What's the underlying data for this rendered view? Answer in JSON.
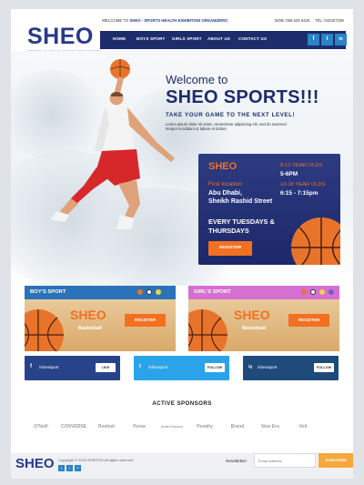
{
  "header": {
    "logo": "SHEO",
    "logo_tagline": "SPORTS HEALTH EXHIBITION ORGANIZERS",
    "welcome_prefix": "WELCOME TO",
    "welcome_brand": "SHEO - SPORTS HEALTH EXHIBITION ORGANIZERS",
    "mob": "MOB: 055 626 6426",
    "tel": "TEL: 044307199"
  },
  "nav": {
    "items": [
      "HOME",
      "BOYS SPORT",
      "GIRLS SPORT",
      "ABOUT US",
      "CONTACT US"
    ],
    "social": [
      "f",
      "t",
      "in"
    ]
  },
  "hero": {
    "welcome": "Welcome to",
    "title": "SHEO SPORTS!!!",
    "subtitle": "TAKE YOUR GAME TO THE NEXT LEVEL!",
    "lorem_1": "Lorem ipsum dolor sit amet, consectetur adipiscing elit, sed do eiusmod",
    "lorem_2": "tempor incididunt ut labore et dolore."
  },
  "info_card": {
    "logo": "SHEO",
    "age_group_1": "8-12 YEAR OLDS",
    "time_1": "5-6PM",
    "location_label": "First location",
    "age_group_2": "13-18 YEAR OLDS",
    "time_2": "6:15 - 7:15pm",
    "place_1": "Abu Dhabi,",
    "place_2": "Sheikh Rashid Street",
    "days_1": "EVERY TUESDAYS &",
    "days_2": "THURSDAYS",
    "register": "REGISTER"
  },
  "sports": [
    {
      "title": "BOY'S SPORT",
      "logo": "SHEO",
      "label": "Basketball",
      "register": "REGISTER",
      "color": "#2b73b8"
    },
    {
      "title": "GIRL'S SPORT",
      "logo": "SHEO",
      "label": "Basketball",
      "register": "REGISTER",
      "color": "#d56fd1"
    }
  ],
  "social_row": [
    {
      "icon": "f",
      "name": "/sheosport",
      "button": "LIKE",
      "color": "#27448a"
    },
    {
      "icon": "t",
      "name": "/sheosport",
      "button": "FOLLOW",
      "color": "#2aa3e8"
    },
    {
      "icon": "ig",
      "name": "/sheosport",
      "button": "FOLLOW",
      "color": "#1f4a7c"
    }
  ],
  "sponsors": {
    "title": "ACTIVE SPONSORS",
    "names": [
      "O'Neill",
      "CONVERSE",
      "Reebok",
      "Puma",
      "Under Armour",
      "Penalty",
      "Brand",
      "New Era",
      "Voit"
    ]
  },
  "footer": {
    "logo": "SHEO",
    "copyright": "Copyright © 2015 SHEOTM all rights reserved",
    "social": [
      "f",
      "t",
      "in"
    ],
    "newsletter_label": "Newsletter:",
    "email_placeholder": "Email Address",
    "subscribe": "SUBSCRIBE"
  },
  "colors": {
    "brand_navy": "#1d2c6b",
    "accent_orange": "#f37021",
    "boys_blue": "#2b73b8",
    "girls_pink": "#d56fd1"
  }
}
